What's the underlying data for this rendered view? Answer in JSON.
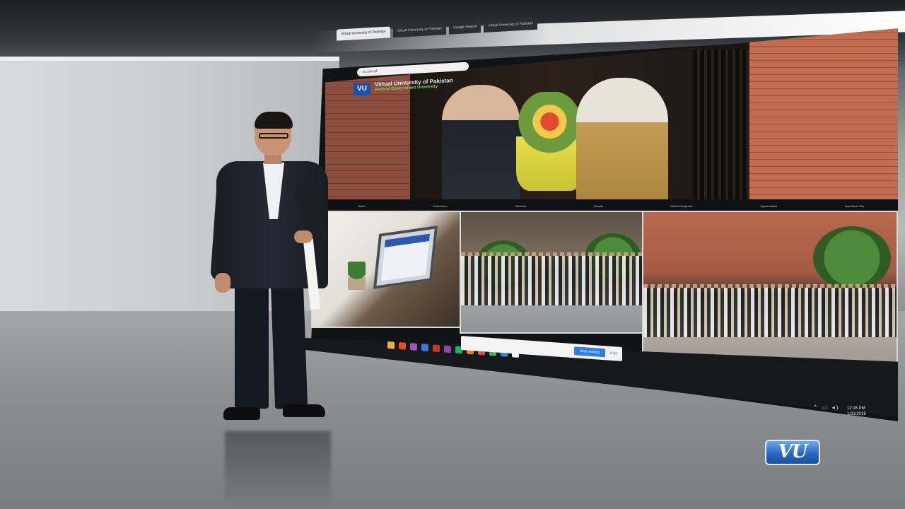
{
  "browser": {
    "tabs": [
      "Virtual University of Pakistan",
      "Virtual University of Pakistan",
      "Google Search",
      "Virtual University of Pakistan"
    ],
    "address": "vu.edu.pk"
  },
  "site": {
    "logo_text": "VU",
    "title": "Virtual University of Pakistan",
    "subtitle": "Federal Government University",
    "nav": [
      "Home",
      "Admissions",
      "Students",
      "Faculty",
      "Virtual Campuses",
      "Opportunities",
      "Important Links"
    ],
    "thumb_captions": [
      "",
      "",
      ""
    ]
  },
  "screen_share": {
    "message": "",
    "stop_label": "Stop sharing",
    "hide_label": "Hide"
  },
  "taskbar": {
    "time": "12:16 PM",
    "date": "1/31/2019"
  },
  "watermark": {
    "logo_text": "VU",
    "tagline": ""
  },
  "colors": {
    "vu_blue": "#2a68c3",
    "share_button": "#2f7de1",
    "studio_floor": "#8d8f92"
  }
}
